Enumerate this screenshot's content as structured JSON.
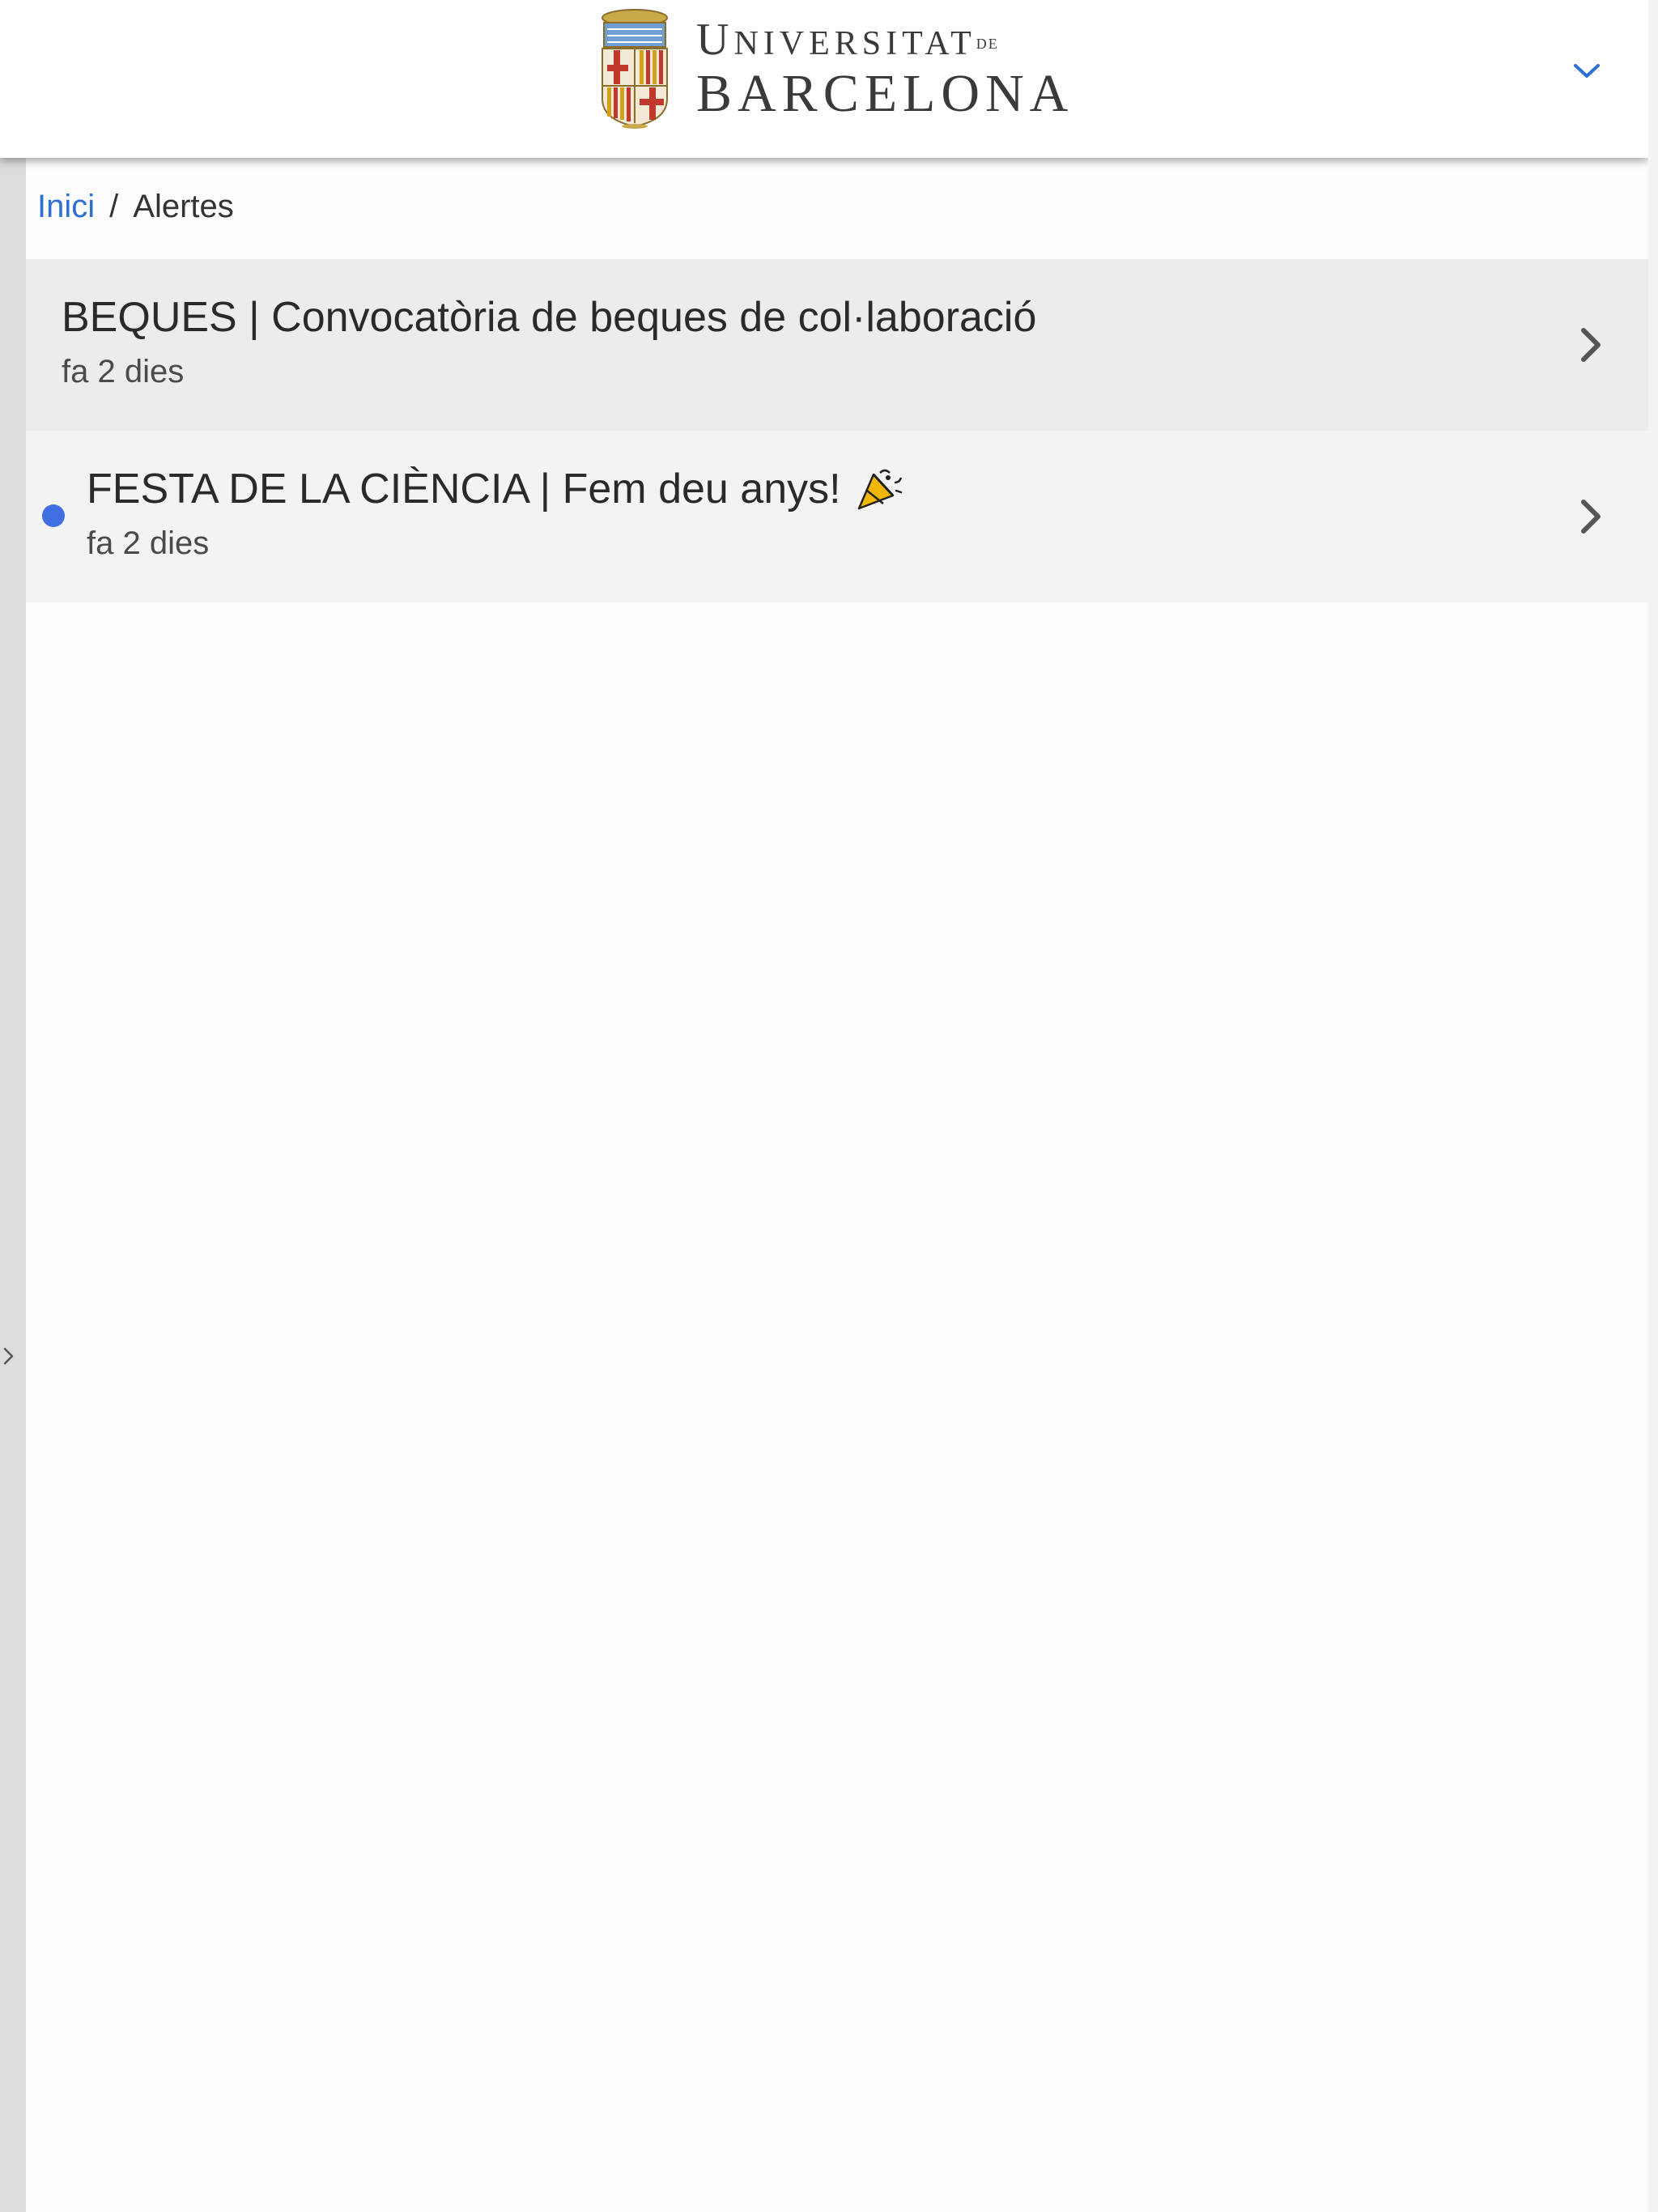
{
  "header": {
    "logo_alt": "Universitat de Barcelona",
    "logo_line1_initial": "U",
    "logo_line1_rest": "NIVERSITAT",
    "logo_line1_suffix": "DE",
    "logo_line2": "BARCELONA",
    "toggle_icon": "chevron-down-icon",
    "accent_color": "#2d6fd2"
  },
  "breadcrumb": {
    "home_label": "Inici",
    "separator": "/",
    "current_label": "Alertes"
  },
  "alerts": [
    {
      "title": "BEQUES | Convocatòria de beques de col·laboració",
      "time": "fa 2 dies",
      "unread": false
    },
    {
      "title": "FESTA DE LA CIÈNCIA | Fem deu anys!",
      "time": "fa 2 dies",
      "unread": true,
      "emoji": "party-popper-icon"
    }
  ],
  "sidebar": {
    "toggle_icon": "chevron-right-icon"
  },
  "colors": {
    "unread_dot": "#3f6fe0",
    "read_background": "#ececec",
    "unread_background": "#f3f3f3",
    "link": "#2d6fd2"
  }
}
